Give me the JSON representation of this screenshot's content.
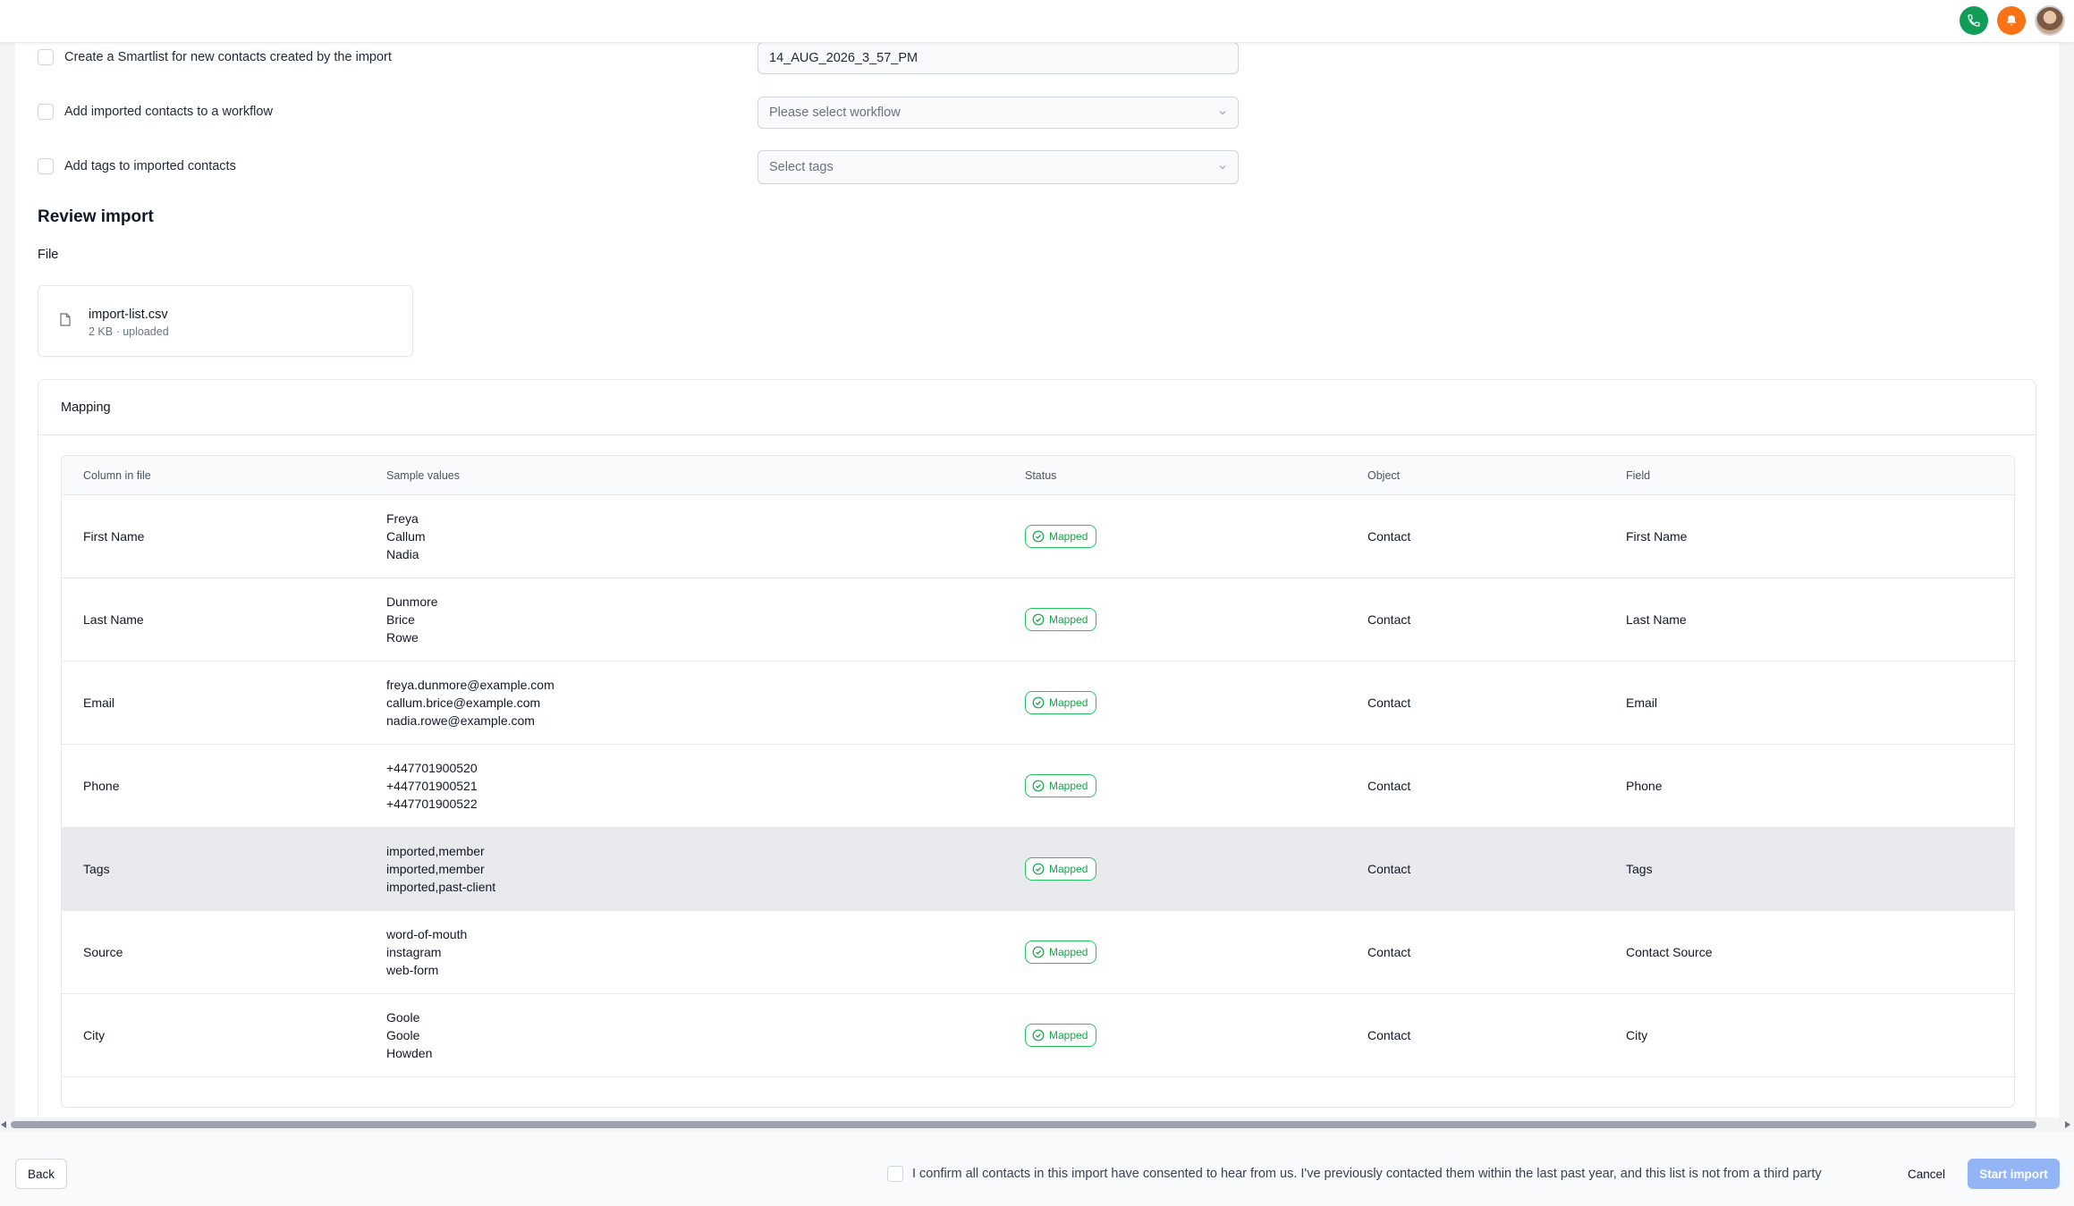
{
  "options": {
    "smartlist": {
      "label": "Create a Smartlist for new contacts created by the import",
      "value": "14_AUG_2026_3_57_PM"
    },
    "workflow": {
      "label": "Add imported contacts to a workflow",
      "placeholder": "Please select workflow"
    },
    "tags": {
      "label": "Add tags to imported contacts",
      "placeholder": "Select tags"
    }
  },
  "review": {
    "title": "Review import",
    "file_label": "File",
    "file_name": "import-list.csv",
    "file_meta": "2 KB · uploaded"
  },
  "mapping": {
    "title": "Mapping",
    "headers": [
      "Column in file",
      "Sample values",
      "Status",
      "Object",
      "Field"
    ],
    "rows": [
      {
        "column": "First Name",
        "samples": [
          "Freya",
          "Callum",
          "Nadia"
        ],
        "status": "Mapped",
        "object": "Contact",
        "field": "First Name"
      },
      {
        "column": "Last Name",
        "samples": [
          "Dunmore",
          "Brice",
          "Rowe"
        ],
        "status": "Mapped",
        "object": "Contact",
        "field": "Last Name"
      },
      {
        "column": "Email",
        "samples": [
          "freya.dunmore@example.com",
          "callum.brice@example.com",
          "nadia.rowe@example.com"
        ],
        "status": "Mapped",
        "object": "Contact",
        "field": "Email"
      },
      {
        "column": "Phone",
        "samples": [
          "+447701900520",
          "+447701900521",
          "+447701900522"
        ],
        "status": "Mapped",
        "object": "Contact",
        "field": "Phone"
      },
      {
        "column": "Tags",
        "samples": [
          "imported,member",
          "imported,member",
          "imported,past-client"
        ],
        "status": "Mapped",
        "object": "Contact",
        "field": "Tags"
      },
      {
        "column": "Source",
        "samples": [
          "word-of-mouth",
          "instagram",
          "web-form"
        ],
        "status": "Mapped",
        "object": "Contact",
        "field": "Contact Source"
      },
      {
        "column": "City",
        "samples": [
          "Goole",
          "Goole",
          "Howden"
        ],
        "status": "Mapped",
        "object": "Contact",
        "field": "City"
      }
    ]
  },
  "footer": {
    "back_label": "Back",
    "consent_text": "I confirm all contacts in this import have consented to hear from us. I've previously contacted them within the last past year, and this list is not from a third party",
    "cancel_label": "Cancel",
    "start_label": "Start import"
  },
  "colors": {
    "mapped": "#16a34a",
    "start_button": "#93b4f5",
    "phone": "#0f9d58",
    "bell": "#f97316"
  }
}
